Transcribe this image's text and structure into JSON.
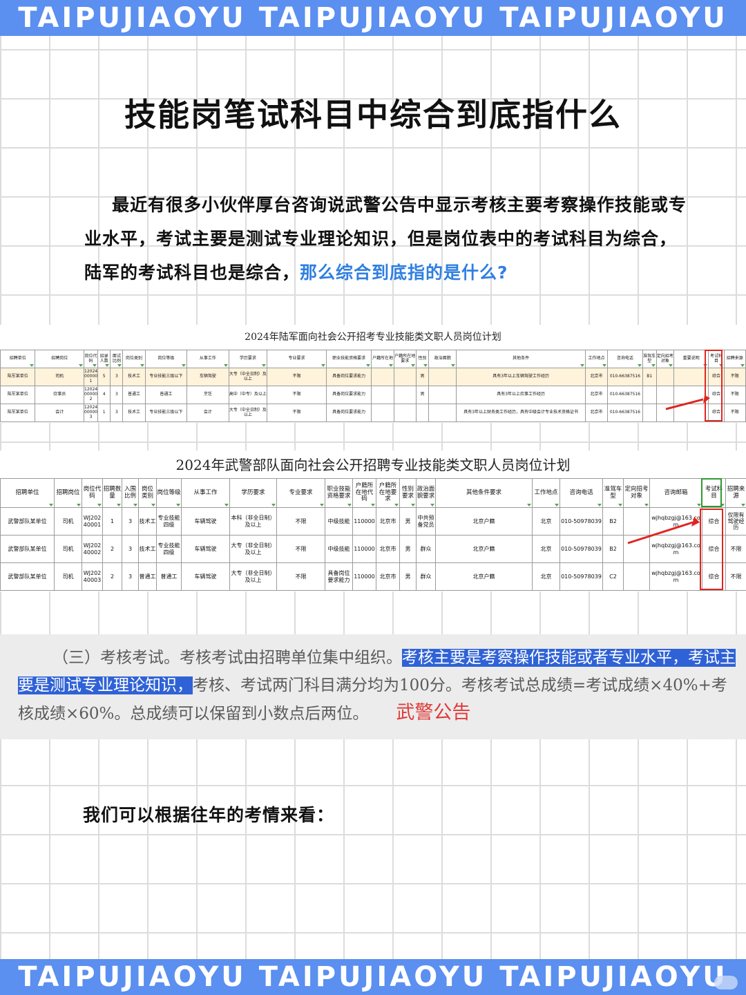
{
  "banner_text": "TAIPUJIAOYU TAIPUJIAOYU TAIPUJIAOYU",
  "title": "技能岗笔试科目中综合到底指什么",
  "intro": {
    "text": "最近有很多小伙伴厚台咨询说武警公告中显示考核主要考察操作技能或专业水平，考试主要是测试专业理论知识，但是岗位表中的考试科目为综合，陆军的考试科目也是综合，",
    "highlight": "那么综合到底指的是什么?"
  },
  "army_table": {
    "title": "2024年陆军面向社会公开招考专业技能类文职人员岗位计划",
    "headers": [
      "招聘单位",
      "招聘岗位",
      "岗位代码",
      "招录人数",
      "面试比例",
      "岗位类别",
      "岗位等级",
      "从事工作",
      "学历要求",
      "专业要求",
      "职业技能资格要求",
      "户籍所在地",
      "户籍所在地要求",
      "性别",
      "政治面貌",
      "其他条件",
      "工作地点",
      "咨询电话",
      "准驾车型",
      "定向招考对象",
      "重要说明",
      "考试科目",
      "招聘来源"
    ],
    "rows": [
      [
        "陆军某单位",
        "司机",
        "12024000001",
        "5",
        "3",
        "技术工",
        "专业技能三级以下",
        "车辆驾驶",
        "大专（中全日制）及以上",
        "不限",
        "具备岗位要求能力",
        "",
        "",
        "男",
        "",
        "具有3年以上车辆驾驶工作经历",
        "北京市",
        "010-66387516",
        "B1",
        "",
        "",
        "综合",
        "不限"
      ],
      [
        "陆军某单位",
        "炊事员",
        "12024000002",
        "4",
        "3",
        "普通工",
        "普通工",
        "烹饪",
        "高中（中专）及以上",
        "不限",
        "具备岗位要求能力",
        "",
        "",
        "男",
        "",
        "具有3年以上炊事工作经历",
        "北京市",
        "010-66387516",
        "",
        "",
        "",
        "综合",
        "不限"
      ],
      [
        "陆军某单位",
        "会计",
        "12024000003",
        "1",
        "3",
        "技术工",
        "专业技能三级以下",
        "会计",
        "大专（中全日制）及以上",
        "不限",
        "具备岗位要求能力",
        "",
        "",
        "",
        "",
        "具有3年以上财务类工作经历，具有中级会计专业技术资格证书",
        "北京市",
        "010-66387516",
        "",
        "",
        "",
        "综合",
        "不限"
      ]
    ]
  },
  "wj_table": {
    "title": "2024年武警部队面向社会公开招聘专业技能类文职人员岗位计划",
    "headers": [
      "招聘单位",
      "招聘岗位",
      "岗位代码",
      "招聘数量",
      "入围比例",
      "岗位类别",
      "岗位等级",
      "从事工作",
      "学历要求",
      "专业要求",
      "职业技能资格要求",
      "户籍所在地代码",
      "户籍所在地要求",
      "性别要求",
      "政治面貌要求",
      "其他条件要求",
      "工作地点",
      "咨询电话",
      "准驾车型",
      "定向招考对象",
      "咨询邮箱",
      "考试科目",
      "招聘来源"
    ],
    "rows": [
      [
        "武警部队某单位",
        "司机",
        "WJ20240001",
        "1",
        "3",
        "技术工",
        "专业技能四级",
        "车辆驾驶",
        "本科（非全日制）及以上",
        "不限",
        "中级技能",
        "110000",
        "北京市",
        "男",
        "中共预备党员",
        "北京户籍",
        "北京",
        "010-50978039",
        "B2",
        "",
        "wjhqbzgj@163.com",
        "综合",
        "仅限有驾驶经历"
      ],
      [
        "武警部队某单位",
        "司机",
        "WJ20240002",
        "2",
        "3",
        "技术工",
        "专业技能四级",
        "车辆驾驶",
        "大专（非全日制）及以上",
        "不限",
        "中级技能",
        "110000",
        "北京市",
        "男",
        "群众",
        "北京户籍",
        "北京",
        "010-50978039",
        "B2",
        "",
        "wjhqbzgj@163.com",
        "综合",
        "不限"
      ],
      [
        "武警部队某单位",
        "司机",
        "WJ20240003",
        "2",
        "3",
        "普通工",
        "普通工",
        "车辆驾驶",
        "大专（非全日制）及以上",
        "不限",
        "具备岗位要求能力",
        "110000",
        "北京市",
        "男",
        "群众",
        "北京户籍",
        "北京",
        "010-50978039",
        "C2",
        "",
        "wjhqbzgj@163.com",
        "综合",
        "不限"
      ]
    ]
  },
  "excerpt": {
    "part1": "（三）考核考试。考核考试由招聘单位集中组织。",
    "highlight": "考核主要是考察操作技能或者专业水平，考试主要是测试专业理论知识，",
    "part2": "考核、考试两门科目满分均为100分。考核考试总成绩=考试成绩×40%+考核成绩×60%。总成绩可以保留到小数点后两位。",
    "source": "武警公告"
  },
  "closing": "我们可以根据往年的考情来看：",
  "colors": {
    "banner": "#5b8ff0",
    "highlight_text": "#2f7fe0",
    "excerpt_mark": "#2f62d6",
    "source_red": "#e03a3a",
    "box_red": "#e0251f",
    "box_green": "#2f9a2f"
  }
}
